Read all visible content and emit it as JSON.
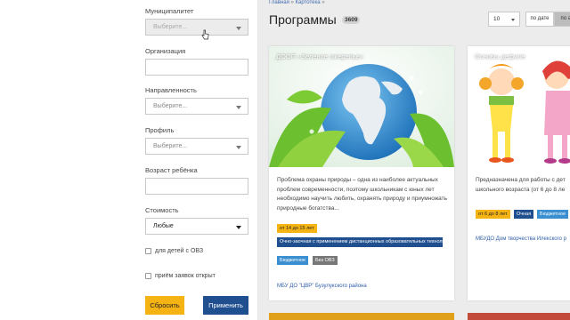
{
  "filters": {
    "municipality_label": "Муниципалитет",
    "municipality_placeholder": "Выберите...",
    "organization_label": "Организация",
    "direction_label": "Направленность",
    "direction_placeholder": "Выберите...",
    "profile_label": "Профиль",
    "profile_placeholder": "Выберите...",
    "age_label": "Возраст ребёнка",
    "cost_label": "Стоимость",
    "cost_value": "Любые",
    "ovz_label": "для детей с ОВЗ",
    "open_label": "приём заявок открыт",
    "reset_label": "Сбросить",
    "apply_label": "Применить"
  },
  "breadcrumb": {
    "home": "Главная",
    "sep": "»",
    "catalog": "Картотека"
  },
  "header": {
    "title": "Программы",
    "count": "3609",
    "per_page": "10",
    "sort_date": "по дате",
    "sort_other": "по ал"
  },
  "cards": [
    {
      "title": "ДООП «Зеленое ожерелье»",
      "desc": "Проблема охраны природы – одна из наиболее актуальных проблем современности, поэтому школьникам с юных лет необходимо научить любить, охранять природу и приумножать природные богатства...",
      "age": "от 14 до 15 лет",
      "format": "Очно-заочная с применением дистанционных образовательных технологий",
      "budget": "Бюджетное",
      "ovz": "Без ОВЗ",
      "org": "МБУ ДО \"ЦВР\" Бузулукского района"
    },
    {
      "title": "Основы дефиле",
      "desc_line1": "Предназначена для работы с дет",
      "desc_line2": "школьного возраста (от 6 до 8 ле",
      "age": "от 6 до 8 лет",
      "format": "Очная",
      "budget": "Бюджетное",
      "org": "МБУДО Дом творчества Илекского р"
    }
  ],
  "colors": {
    "accent_yellow": "#f5b414",
    "primary_blue": "#1f4f8f",
    "link_blue": "#2f5ea8"
  }
}
